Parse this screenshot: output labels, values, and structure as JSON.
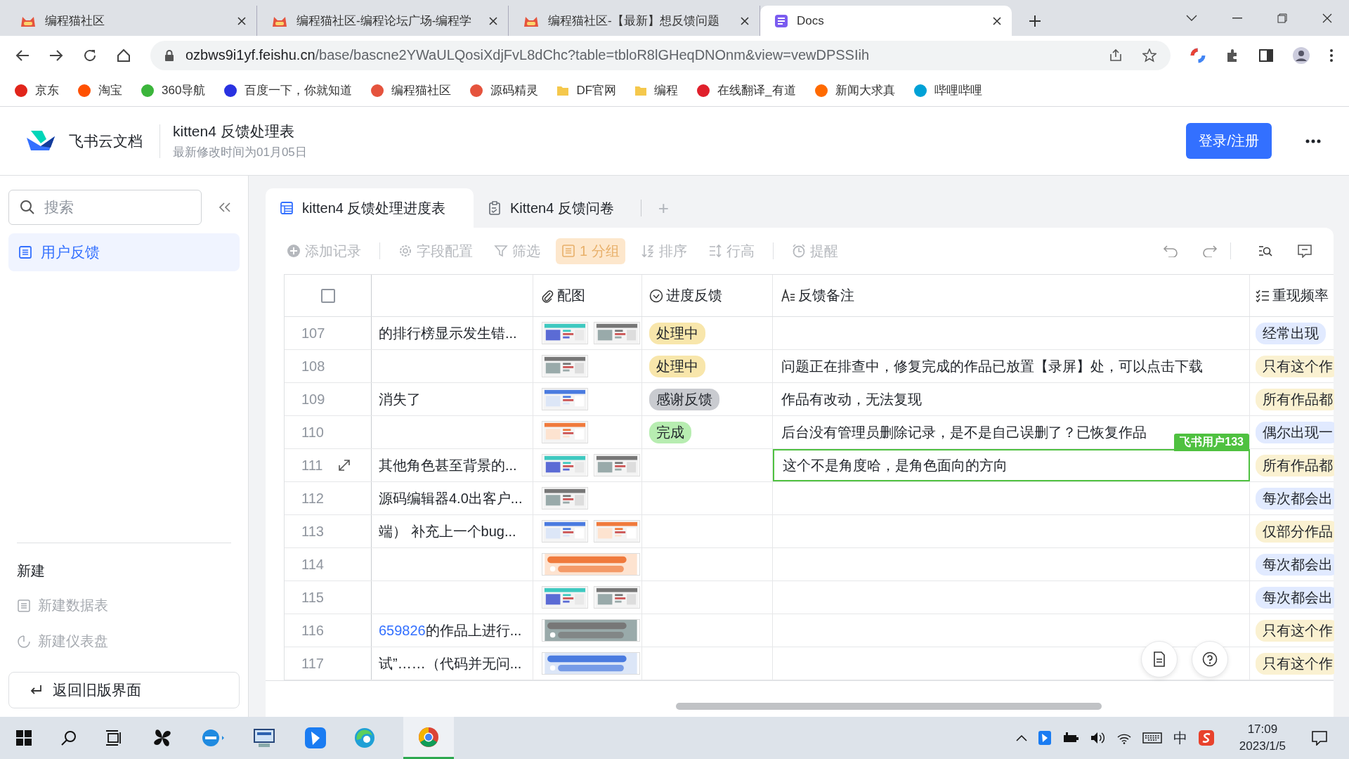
{
  "browser": {
    "tabs": [
      {
        "title": "编程猫社区",
        "kind": "site",
        "selected": false
      },
      {
        "title": "编程猫社区-编程论坛广场-编程学",
        "kind": "site",
        "selected": false
      },
      {
        "title": "编程猫社区-【最新】想反馈问题",
        "kind": "site",
        "selected": false
      },
      {
        "title": "Docs",
        "kind": "docs",
        "selected": true
      }
    ],
    "address": {
      "host": "ozbws9i1yf.feishu.cn",
      "path": "/base/bascne2YWaULQosiXdjFvL8dChc?table=tbloR8lGHeqDNOnm&view=vewDPSSIih"
    },
    "bookmarks": [
      {
        "label": "京东",
        "kind": "logo",
        "color": "#e1251b"
      },
      {
        "label": "淘宝",
        "kind": "logo",
        "color": "#ff5000"
      },
      {
        "label": "360导航",
        "kind": "logo",
        "color": "#3bb53b"
      },
      {
        "label": "百度一下，你就知道",
        "kind": "logo",
        "color": "#2932e1"
      },
      {
        "label": "编程猫社区",
        "kind": "logo",
        "color": "#e5533d"
      },
      {
        "label": "源码精灵",
        "kind": "logo",
        "color": "#e5533d"
      },
      {
        "label": "DF官网",
        "kind": "folder",
        "color": "#f5c84c"
      },
      {
        "label": "编程",
        "kind": "folder",
        "color": "#f5c84c"
      },
      {
        "label": "在线翻译_有道",
        "kind": "logo",
        "color": "#e0202b"
      },
      {
        "label": "新闻大求真",
        "kind": "logo",
        "color": "#ff6a00"
      },
      {
        "label": "哔哩哔哩",
        "kind": "logo",
        "color": "#00a1d6"
      }
    ]
  },
  "header": {
    "brand": "飞书云文档",
    "title": "kitten4 反馈处理表",
    "subtitle": "最新修改时间为01月05日",
    "login_button": "登录/注册"
  },
  "sidebar": {
    "search": {
      "placeholder": "搜索"
    },
    "items": [
      {
        "label": "用户反馈",
        "selected": true
      }
    ],
    "section_title": "新建",
    "new_items": [
      {
        "label": "新建数据表",
        "kind": "table",
        "disabled": true
      },
      {
        "label": "新建仪表盘",
        "kind": "dashboard",
        "disabled": true
      }
    ],
    "back_button": "返回旧版界面"
  },
  "view_tabs": [
    {
      "label": "kitten4 反馈处理进度表",
      "kind": "table",
      "selected": true
    },
    {
      "label": "Kitten4 反馈问卷",
      "kind": "form",
      "selected": false
    }
  ],
  "add_tab": "+",
  "toolbar": [
    {
      "label": "添加记录",
      "kind": "add",
      "disabled": true,
      "selected": false
    },
    {
      "label": "字段配置",
      "kind": "gear",
      "disabled": true,
      "selected": false
    },
    {
      "label": "筛选",
      "kind": "filter",
      "disabled": true,
      "selected": false
    },
    {
      "label": "1 分组",
      "kind": "group",
      "disabled": true,
      "selected": true
    },
    {
      "label": "排序",
      "kind": "sort",
      "disabled": true,
      "selected": false
    },
    {
      "label": "行高",
      "kind": "height",
      "disabled": true,
      "selected": false
    },
    {
      "label": "提醒",
      "kind": "alarm",
      "disabled": true,
      "selected": false
    }
  ],
  "table": {
    "select_all": {
      "checked": false
    },
    "columns": [
      {
        "label": "配图",
        "kind": "attachment"
      },
      {
        "label": "进度反馈",
        "kind": "status"
      },
      {
        "label": "反馈备注",
        "kind": "text"
      },
      {
        "label": "重现频率",
        "kind": "options"
      }
    ],
    "rows": [
      {
        "number": "107",
        "expand": false,
        "title": {
          "text": "的排行榜显示发生错..."
        },
        "status": {
          "text": "处理中",
          "color": "#f8e6ab"
        },
        "note": "",
        "note_selected": false,
        "frequency": {
          "text": "经常出现",
          "color": "#e1eaff"
        }
      },
      {
        "number": "108",
        "expand": false,
        "status": {
          "text": "处理中",
          "color": "#f8e6ab"
        },
        "note": "问题正在排查中，修复完成的作品已放置【录屏】处，可以点击下载",
        "note_selected": false,
        "frequency": {
          "text": "只有这个作",
          "color": "#faf1d1"
        }
      },
      {
        "number": "109",
        "expand": false,
        "title": {
          "text": "消失了"
        },
        "status": {
          "text": "感谢反馈",
          "color": "#c9cbd0"
        },
        "note": "作品有改动，无法复现",
        "note_selected": false,
        "frequency": {
          "text": "所有作品都",
          "color": "#faf1d1"
        }
      },
      {
        "number": "110",
        "expand": false,
        "status": {
          "text": "完成",
          "color": "#b7edb1"
        },
        "note": "后台没有管理员删除记录，是不是自己误删了？已恢复作品",
        "note_selected": false,
        "frequency": {
          "text": "偶尔出现一",
          "color": "#e1eaff"
        }
      },
      {
        "number": "111",
        "expand": true,
        "title": {
          "text": "其他角色甚至背景的..."
        },
        "note": "这个不是角度哈，是角色面向的方向",
        "note_selected": true,
        "collaborator": "飞书用户133",
        "frequency": {
          "text": "所有作品都",
          "color": "#faf1d1"
        }
      },
      {
        "number": "112",
        "expand": false,
        "title": {
          "text": "源码编辑器4.0出客户..."
        },
        "note": "",
        "note_selected": false,
        "frequency": {
          "text": "每次都会出",
          "color": "#e1eaff"
        }
      },
      {
        "number": "113",
        "expand": false,
        "title": {
          "text": "端） 补充上一个bug..."
        },
        "note": "",
        "note_selected": false,
        "frequency": {
          "text": "仅部分作品",
          "color": "#faf1d1"
        }
      },
      {
        "number": "114",
        "expand": false,
        "images": [
          {
            "kind": "wide"
          }
        ],
        "note": "",
        "note_selected": false,
        "frequency": {
          "text": "每次都会出",
          "color": "#e1eaff"
        }
      },
      {
        "number": "115",
        "expand": false,
        "note": "",
        "note_selected": false,
        "frequency": {
          "text": "每次都会出",
          "color": "#e1eaff"
        }
      },
      {
        "number": "116",
        "expand": false,
        "title": {
          "link": "659826",
          "text": "的作品上进行..."
        },
        "images": [
          {
            "kind": "wide"
          }
        ],
        "note": "",
        "note_selected": false,
        "frequency": {
          "text": "只有这个作",
          "color": "#faf1d1"
        }
      },
      {
        "number": "117",
        "expand": false,
        "title": {
          "text": "试”……（代码并无问..."
        },
        "images": [
          {
            "kind": "wide"
          }
        ],
        "note": "",
        "note_selected": false,
        "frequency": {
          "text": "只有这个作",
          "color": "#faf1d1"
        }
      }
    ]
  },
  "taskbar": {
    "ime": "中",
    "time": "17:09",
    "date": "2023/1/5"
  }
}
